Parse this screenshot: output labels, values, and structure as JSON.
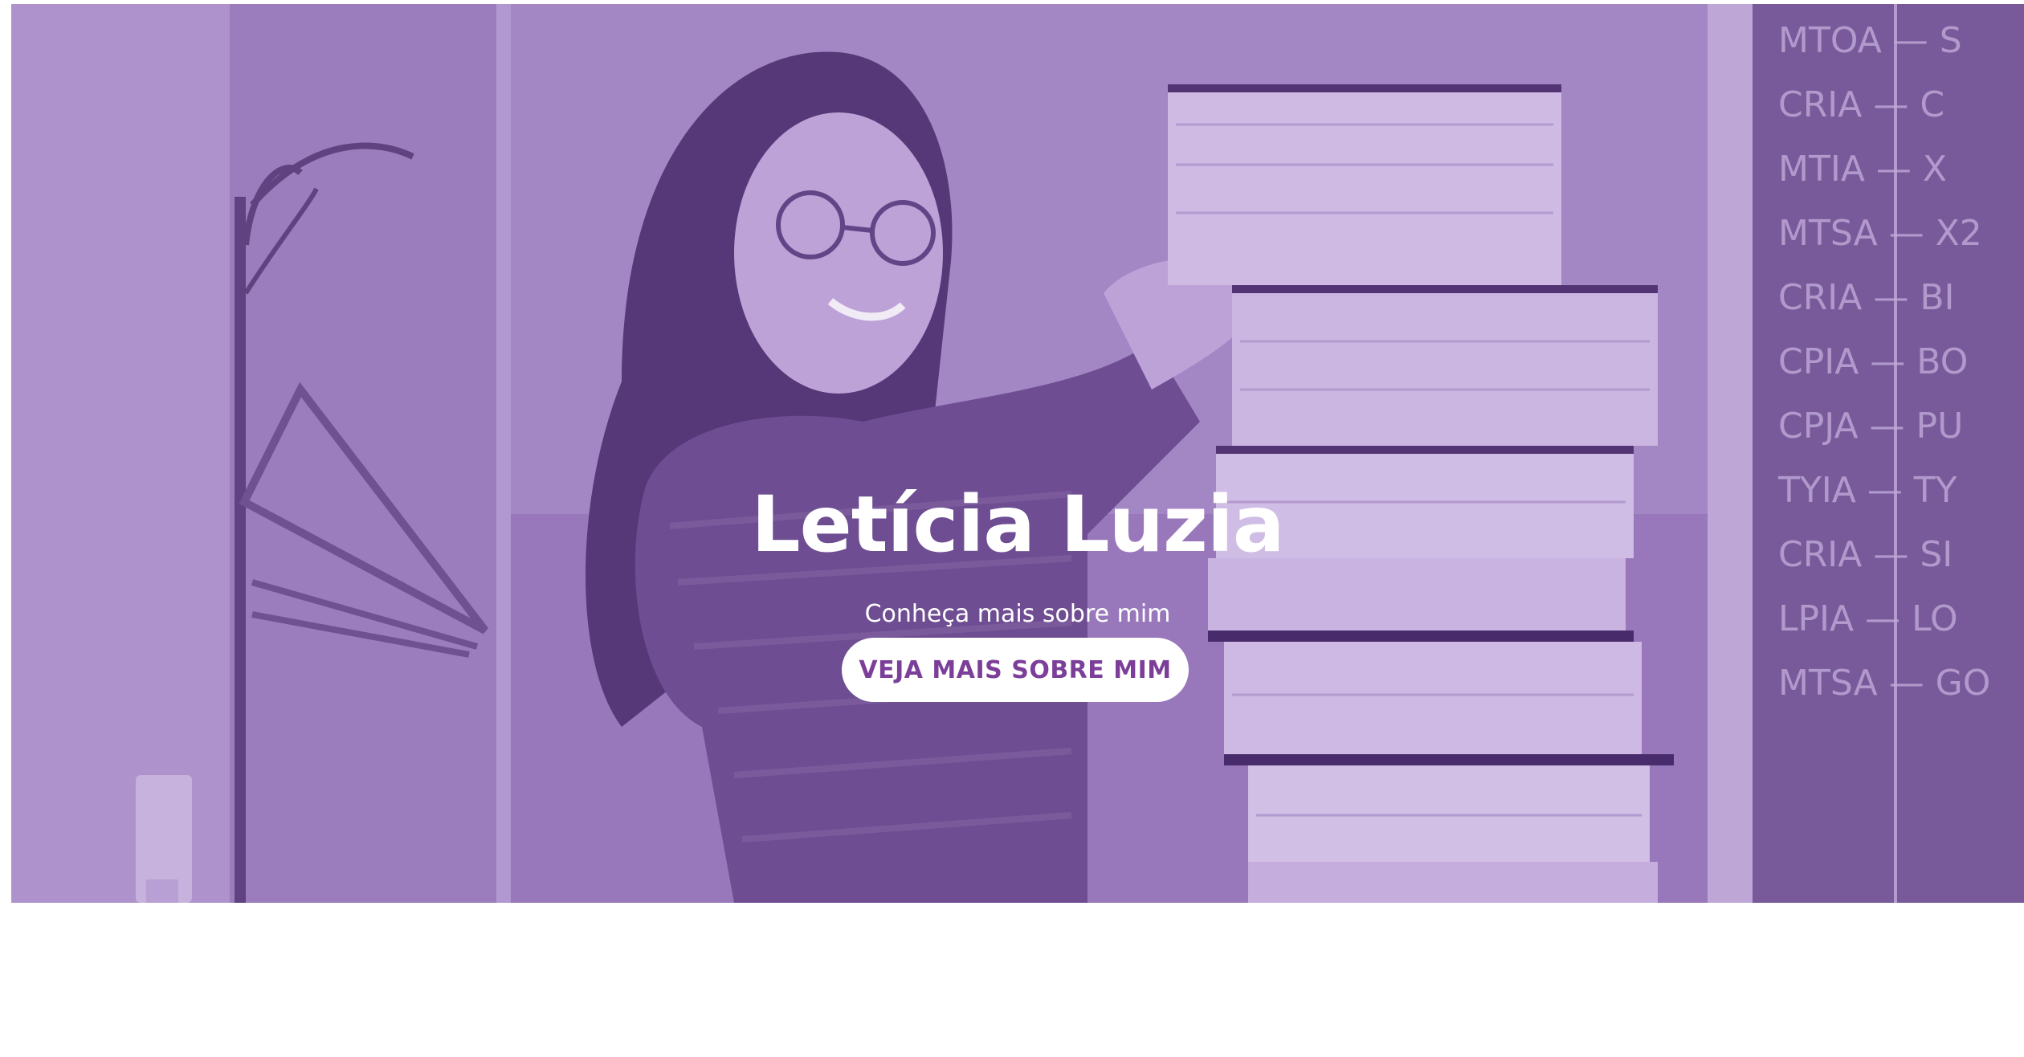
{
  "hero": {
    "title": "Letícia Luzia",
    "subtitle": "Conheça mais sobre mim",
    "cta_label": "VEJA MAIS SOBRE MIM",
    "overlay_color": "#a78cc6",
    "accent_color": "#7c3f99",
    "photo": {
      "subject": "woman-holding-stack-of-books",
      "chalkboard_text": [
        "MTOA",
        "CRIA",
        "MTIA",
        "MTSA",
        "CRIA",
        "CPIA",
        "CPJA",
        "TYIA",
        "CRIA",
        "LPIA",
        "MTSA"
      ]
    }
  }
}
